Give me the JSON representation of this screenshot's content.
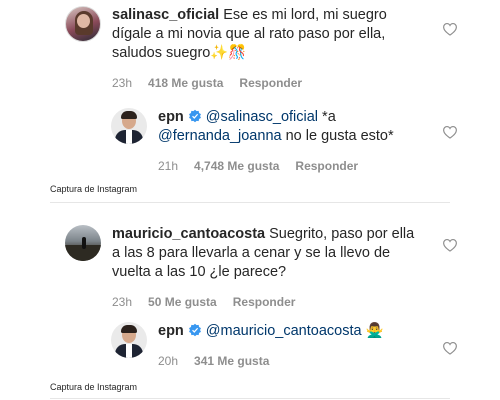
{
  "threads": [
    {
      "comment": {
        "username": "salinasc_oficial",
        "text": "Ese es mi lord, mi suegro dígale a mi novia que al rato paso por ella, saludos suegro",
        "emoji": "✨🎊",
        "time": "23h",
        "likes": "418 Me gusta",
        "reply_label": "Responder"
      },
      "reply": {
        "username": "epn",
        "verified": true,
        "mention1": "@salinasc_oficial",
        "text1": " *a ",
        "mention2": "@fernanda_joanna",
        "text2": " no le gusta esto*",
        "time": "21h",
        "likes": "4,748 Me gusta",
        "reply_label": "Responder"
      },
      "caption": "Captura de Instagram"
    },
    {
      "comment": {
        "username": "mauricio_cantoacosta",
        "text": "Suegrito, paso por ella a las 8 para llevarla a cenar y se la llevo de vuelta a las 10 ¿le parece?",
        "time": "23h",
        "likes": "50 Me gusta",
        "reply_label": "Responder"
      },
      "reply": {
        "username": "epn",
        "verified": true,
        "mention1": "@mauricio_cantoacosta",
        "emoji": "🙅‍♂️",
        "time": "20h",
        "likes": "341 Me gusta"
      },
      "caption": "Captura de Instagram"
    }
  ],
  "icons": {
    "like": "heart-outline-icon",
    "verified": "verified-badge-icon"
  },
  "colors": {
    "text": "#262626",
    "meta": "#8e8e8e",
    "mention": "#00376b",
    "verified": "#3897f0"
  }
}
